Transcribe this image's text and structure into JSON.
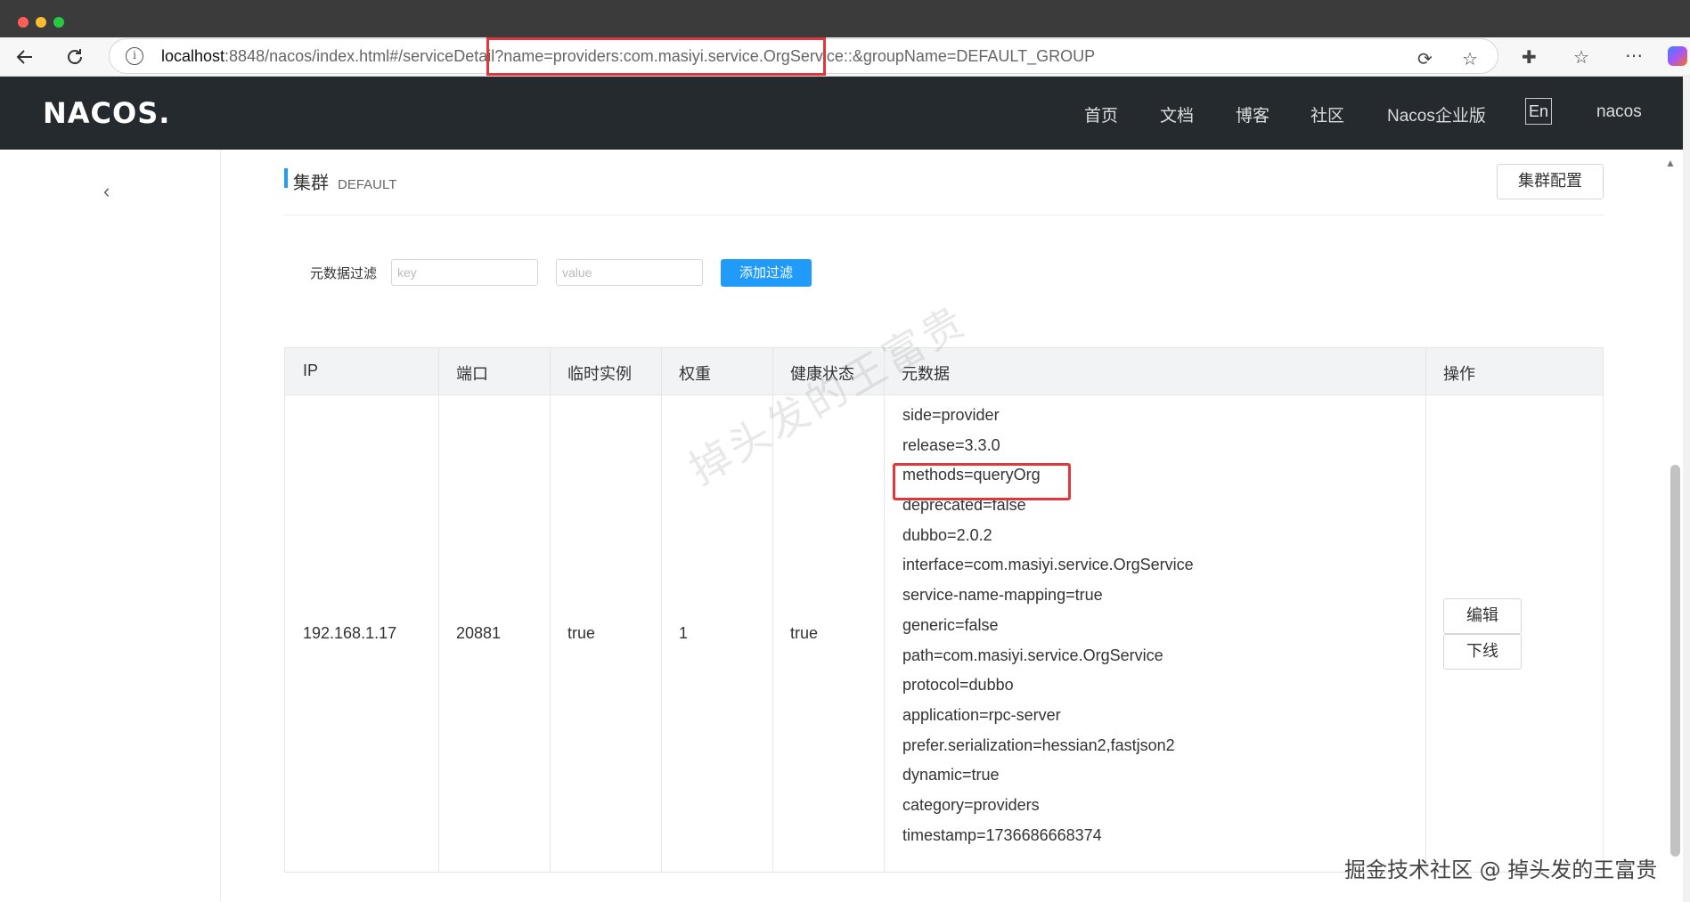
{
  "browser": {
    "url_host": "localhost",
    "url_rest": ":8848/nacos/index.html#/serviceDetail?name=providers:com.masiyi.service.OrgService::&groupName=DEFAULT_GROUP",
    "back_icon": "arrow-left-icon",
    "reload_icon": "reload-icon",
    "info_icon": "info-icon"
  },
  "header": {
    "logo": "NACOS.",
    "nav": [
      "首页",
      "文档",
      "博客",
      "社区",
      "Nacos企业版"
    ],
    "lang": "En",
    "user": "nacos"
  },
  "cluster": {
    "title": "集群",
    "name": "DEFAULT",
    "config_button": "集群配置"
  },
  "filter": {
    "label": "元数据过滤",
    "key_placeholder": "key",
    "value_placeholder": "value",
    "add_button": "添加过滤"
  },
  "table": {
    "columns": [
      "IP",
      "端口",
      "临时实例",
      "权重",
      "健康状态",
      "元数据",
      "操作"
    ],
    "row": {
      "ip": "192.168.1.17",
      "port": "20881",
      "ephemeral": "true",
      "weight": "1",
      "healthy": "true",
      "metadata": [
        "side=provider",
        "release=3.3.0",
        "methods=queryOrg",
        "deprecated=false",
        "dubbo=2.0.2",
        "interface=com.masiyi.service.OrgService",
        "service-name-mapping=true",
        "generic=false",
        "path=com.masiyi.service.OrgService",
        "protocol=dubbo",
        "application=rpc-server",
        "prefer.serialization=hessian2,fastjson2",
        "dynamic=true",
        "category=providers",
        "timestamp=1736686668374"
      ],
      "actions": [
        "编辑",
        "下线"
      ]
    }
  },
  "watermark": "掉头发的王富贵",
  "footer_watermark": "掘金技术社区 @ 掉头发的王富贵",
  "colors": {
    "accent": "#209bfa",
    "header_bg": "#252a2f",
    "highlight": "#e0383a"
  }
}
